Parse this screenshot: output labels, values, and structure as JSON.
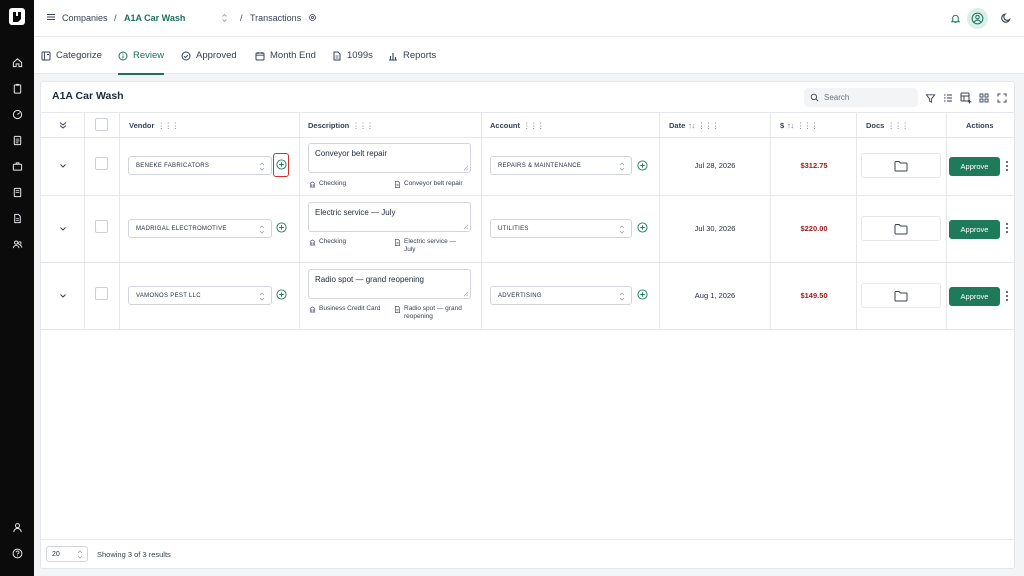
{
  "header": {
    "companies_label": "Companies",
    "separator1": "/",
    "company_name": "A1A Car Wash",
    "separator2": "/",
    "page_label": "Transactions"
  },
  "tabs": [
    {
      "label": "Categorize",
      "icon": "categorize-icon"
    },
    {
      "label": "Review",
      "icon": "info-icon",
      "active": true
    },
    {
      "label": "Approved",
      "icon": "check-circle-icon"
    },
    {
      "label": "Month End",
      "icon": "calendar-icon"
    },
    {
      "label": "1099s",
      "icon": "document-icon"
    },
    {
      "label": "Reports",
      "icon": "bar-chart-icon"
    }
  ],
  "card": {
    "title": "A1A Car Wash",
    "search_placeholder": "Search"
  },
  "columns": {
    "vendor": "Vendor",
    "description": "Description",
    "account": "Account",
    "date": "Date",
    "amount": "$",
    "docs": "Docs",
    "actions": "Actions"
  },
  "rows": [
    {
      "vendor": "BENEKE FABRICATORS",
      "description": "Conveyor belt repair",
      "source": "Checking",
      "memo": "Conveyor belt repair",
      "account": "REPAIRS & MAINTENANCE",
      "date": "Jul 28, 2026",
      "amount": "$312.75",
      "action": "Approve"
    },
    {
      "vendor": "MADRIGAL ELECTROMOTIVE",
      "description": "Electric service — July",
      "source": "Checking",
      "memo_line1": "Electric service —",
      "memo_line2": "July",
      "account": "UTILITIES",
      "date": "Jul 30, 2026",
      "amount": "$220.00",
      "action": "Approve"
    },
    {
      "vendor": "VAMONOS PEST LLC",
      "description": "Radio spot — grand reopening",
      "source": "Business Credit Card",
      "memo_line1": "Radio spot — grand",
      "memo_line2": "reopening",
      "account": "ADVERTISING",
      "date": "Aug 1, 2026",
      "amount": "$149.50",
      "action": "Approve"
    }
  ],
  "footer": {
    "page_size": "20",
    "showing": "Showing 3 of 3 results"
  },
  "colors": {
    "accent": "#1f6f5c",
    "approve": "#1f7a5c",
    "amount": "#991b1b",
    "highlight": "#d32f2f"
  }
}
